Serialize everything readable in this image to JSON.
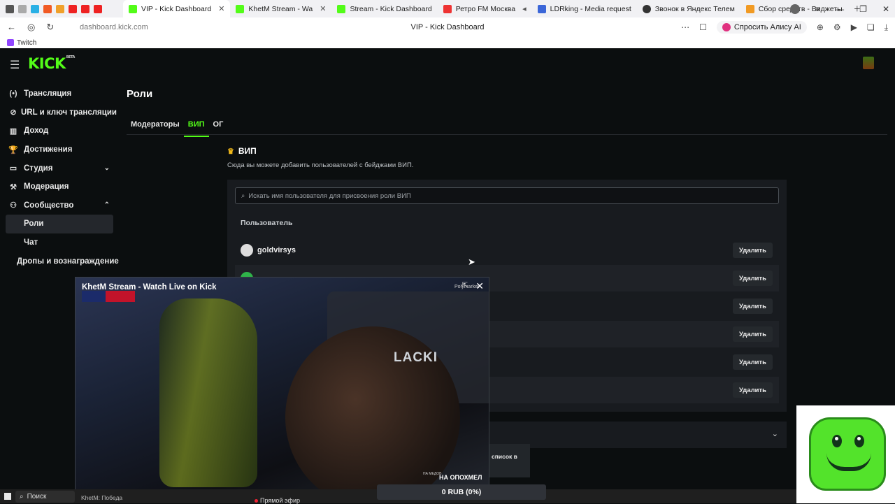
{
  "browser": {
    "tabs": [
      {
        "label": "VIP - Kick Dashboard",
        "color": "#53fc18",
        "active": true
      },
      {
        "label": "KhetM Stream - Wa",
        "color": "#53fc18",
        "active": false
      },
      {
        "label": "Stream - Kick Dashboard",
        "color": "#53fc18",
        "active": false
      },
      {
        "label": "Ретро FM Москва",
        "color": "#e33",
        "active": false
      },
      {
        "label": "LDRking - Media request",
        "color": "#3b66d8",
        "active": false
      },
      {
        "label": "Звонок в Яндекс Телем",
        "color": "#333",
        "active": false
      },
      {
        "label": "Сбор средств - Виджеты",
        "color": "#f19a23",
        "active": false
      }
    ],
    "url": "dashboard.kick.com",
    "page_title": "VIP - Kick Dashboard",
    "alice_label": "Спросить Алису AI",
    "bookmark": "Twitch"
  },
  "sidebar": {
    "items": [
      {
        "label": "Трансляция",
        "icon": "(•)"
      },
      {
        "label": "URL и ключ трансляции",
        "icon": "⊘"
      },
      {
        "label": "Доход",
        "icon": "▥"
      },
      {
        "label": "Достижения",
        "icon": "🏆"
      },
      {
        "label": "Студия",
        "icon": "▭"
      },
      {
        "label": "Модерация",
        "icon": "⚒"
      },
      {
        "label": "Сообщество",
        "icon": "⚇"
      },
      {
        "label": "Роли"
      },
      {
        "label": "Чат"
      },
      {
        "label": "Дропы и вознаграждение"
      }
    ]
  },
  "main": {
    "title": "Роли",
    "tabs": [
      "Модераторы",
      "ВИП",
      "ОГ"
    ],
    "section_title": "ВИП",
    "section_desc": "Сюда вы можете добавить пользователей с бейджами ВИП.",
    "search_placeholder": "Искать имя пользователя для присвоения роли ВИП",
    "column_header": "Пользователь",
    "rows": [
      {
        "user": "goldvirsys",
        "action": "Удалить"
      },
      {
        "user": "",
        "action": "Удалить"
      },
      {
        "user": "",
        "action": "Удалить"
      },
      {
        "user": "",
        "action": "Удалить"
      },
      {
        "user": "",
        "action": "Удалить"
      },
      {
        "user": "",
        "action": "Удалить"
      }
    ],
    "list_button_text": "список в"
  },
  "pip": {
    "title": "KhetM Stream - Watch Live on Kick",
    "brand": "LACKI",
    "poly": "Polymarket",
    "overlay": "НА ОПОХМЕЛ",
    "overlay_small": "НА МЕДОВ",
    "bottom_text": "KhetM: Победа"
  },
  "taskbar": {
    "search": "Поиск",
    "live_label": "Прямой эфир",
    "donation": "0 RUB (0%)"
  }
}
